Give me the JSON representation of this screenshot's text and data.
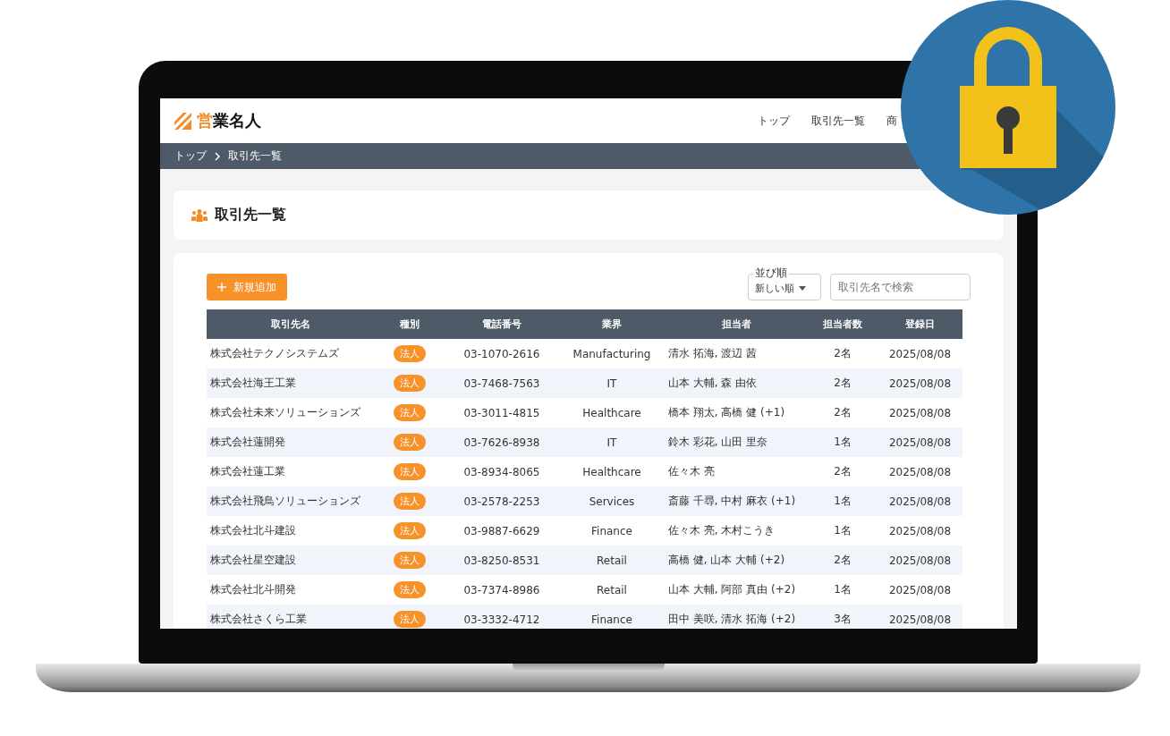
{
  "header": {
    "logo": {
      "accent": "営",
      "rest": "業名人"
    },
    "nav": [
      {
        "label": "トップ"
      },
      {
        "label": "取引先一覧"
      },
      {
        "label": "商"
      }
    ]
  },
  "breadcrumb": [
    {
      "label": "トップ"
    },
    {
      "label": "取引先一覧"
    }
  ],
  "page_title": "取引先一覧",
  "toolbar": {
    "add_button": "新規追加",
    "sort": {
      "label": "並び順",
      "value": "新しい順"
    },
    "search": {
      "placeholder": "取引先名で検索"
    }
  },
  "table": {
    "columns": [
      "取引先名",
      "種別",
      "電話番号",
      "業界",
      "担当者",
      "担当者数",
      "登録日"
    ],
    "rows": [
      {
        "name": "株式会社テクノシステムズ",
        "type": "法人",
        "phone": "03-1070-2616",
        "industry": "Manufacturing",
        "staff": "清水 拓海, 渡辺 茜",
        "count": "2名",
        "date": "2025/08/08"
      },
      {
        "name": "株式会社海王工業",
        "type": "法人",
        "phone": "03-7468-7563",
        "industry": "IT",
        "staff": "山本 大輔, 森 由依",
        "count": "2名",
        "date": "2025/08/08"
      },
      {
        "name": "株式会社未来ソリューションズ",
        "type": "法人",
        "phone": "03-3011-4815",
        "industry": "Healthcare",
        "staff": "橋本 翔太, 高橋 健 (+1)",
        "count": "2名",
        "date": "2025/08/08"
      },
      {
        "name": "株式会社蓮開発",
        "type": "法人",
        "phone": "03-7626-8938",
        "industry": "IT",
        "staff": "鈴木 彩花, 山田 里奈",
        "count": "1名",
        "date": "2025/08/08"
      },
      {
        "name": "株式会社蓮工業",
        "type": "法人",
        "phone": "03-8934-8065",
        "industry": "Healthcare",
        "staff": "佐々木 亮",
        "count": "2名",
        "date": "2025/08/08"
      },
      {
        "name": "株式会社飛鳥ソリューションズ",
        "type": "法人",
        "phone": "03-2578-2253",
        "industry": "Services",
        "staff": "斎藤 千尋, 中村 麻衣 (+1)",
        "count": "1名",
        "date": "2025/08/08"
      },
      {
        "name": "株式会社北斗建設",
        "type": "法人",
        "phone": "03-9887-6629",
        "industry": "Finance",
        "staff": "佐々木 亮, 木村こうき",
        "count": "1名",
        "date": "2025/08/08"
      },
      {
        "name": "株式会社星空建設",
        "type": "法人",
        "phone": "03-8250-8531",
        "industry": "Retail",
        "staff": "高橋 健, 山本 大輔 (+2)",
        "count": "2名",
        "date": "2025/08/08"
      },
      {
        "name": "株式会社北斗開発",
        "type": "法人",
        "phone": "03-7374-8986",
        "industry": "Retail",
        "staff": "山本 大輔, 阿部 真由 (+2)",
        "count": "1名",
        "date": "2025/08/08"
      },
      {
        "name": "株式会社さくら工業",
        "type": "法人",
        "phone": "03-3332-4712",
        "industry": "Finance",
        "staff": "田中 美咲, 清水 拓海 (+2)",
        "count": "3名",
        "date": "2025/08/08"
      }
    ]
  }
}
